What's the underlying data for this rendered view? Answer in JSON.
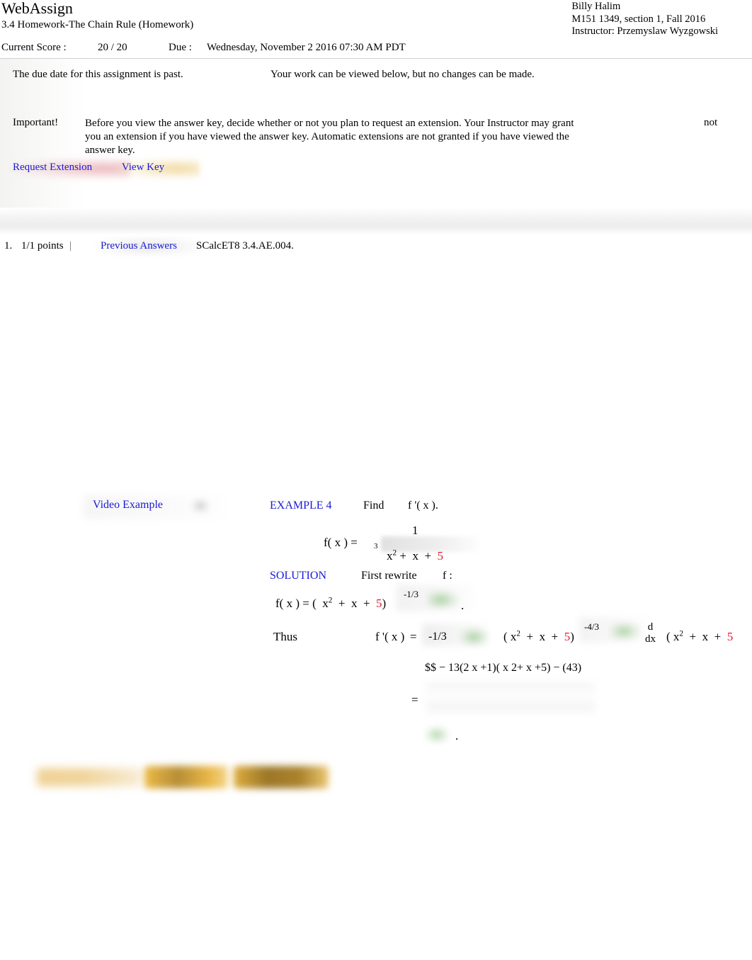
{
  "header": {
    "brand": "WebAssign",
    "assignment_title": "3.4 Homework-The Chain Rule (Homework)",
    "student_name": "Billy Halim",
    "course": "M151 1349, section 1, Fall 2016",
    "instructor": "Instructor: Przemyslaw Wyzgowski"
  },
  "scorebar": {
    "score_label": "Current Score :",
    "score_value": "20 / 20",
    "due_label": "Due :",
    "due_value": "Wednesday, November 2 2016 07:30 AM PDT"
  },
  "notice": {
    "past_due": "The due date for this assignment is past.",
    "viewable": "Your work can be viewed below, but no changes can be made.",
    "important_label": "Important!",
    "important_body": "Before you view the answer key, decide whether or not you plan to request an extension. Your Instructor may grant you an extension if you have viewed the answer key. Automatic extensions are not granted if you have viewed the answer key.",
    "important_not": "not",
    "request_extension_label": "Request Extension",
    "view_key_label": "View Key"
  },
  "question": {
    "number": "1.",
    "points": "1/1 points",
    "separator": "|",
    "previous_answers_label": "Previous Answers",
    "code": "SCalcET8 3.4.AE.004.",
    "video_example_label": "Video Example",
    "example_title": "EXAMPLE 4",
    "find_label": "Find",
    "find_target": "f '( x ).",
    "problem": {
      "lhs": "f( x ) =",
      "numerator": "1",
      "root_index": "3",
      "radicand_a": "x",
      "radicand_a_exp": "2",
      "radicand_plus1": "+",
      "radicand_b": "x",
      "radicand_plus2": "+",
      "radicand_c": "5"
    },
    "solution": {
      "title": "SOLUTION",
      "first_rewrite": "First rewrite",
      "f_colon": "f :",
      "rewrite_lhs": "f( x ) = (",
      "rewrite_a": "x",
      "rewrite_a_exp": "2",
      "rewrite_plus1": "+",
      "rewrite_b": "x",
      "rewrite_plus2": "+",
      "rewrite_c": "5",
      "rewrite_close": ")",
      "rewrite_exponent": "-1/3",
      "rewrite_period": ".",
      "thus_label": "Thus",
      "thus_fprime": "f '( x )",
      "thus_equals": "=",
      "answer_coefficient": "-1/3",
      "thus_paren": "( x",
      "thus_paren_exp": "2",
      "thus_paren_plus1": "+",
      "thus_paren_b": "x",
      "thus_paren_plus2": "+",
      "thus_paren_c": "5",
      "thus_paren_close": ")",
      "thus_exponent": "-4/3",
      "ddx_num": "d",
      "ddx_den": "dx",
      "tail_open": "( x",
      "tail_exp": "2",
      "tail_plus1": "+",
      "tail_b": "x",
      "tail_plus2": "+",
      "tail_c": "5",
      "latex_raw": "$$ − 13(2  x +1)(  x 2+  x +5)  − (43)",
      "final_equals": "=",
      "final_period": "."
    }
  },
  "colors": {
    "link": "#1919d6",
    "red_term": "#e3192b",
    "correct_green": "#96c68e",
    "help_amber": "#e6b43c"
  }
}
